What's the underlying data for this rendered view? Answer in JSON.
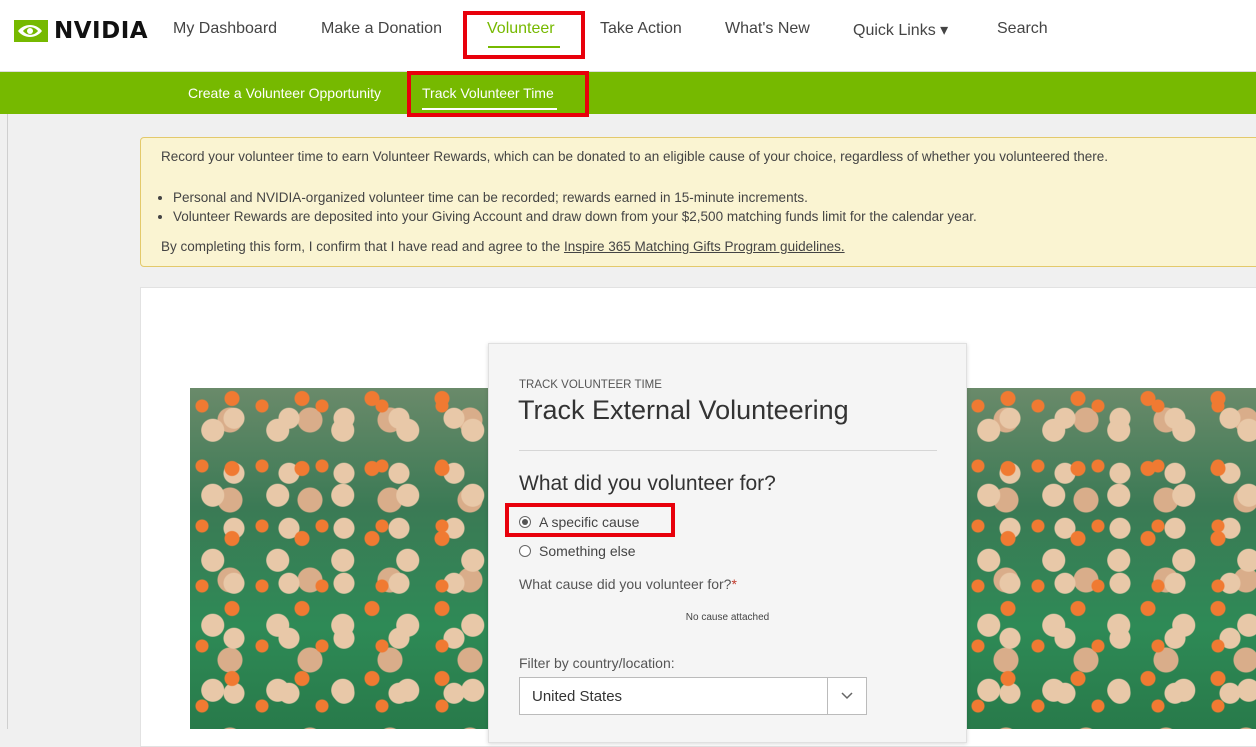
{
  "brand": {
    "name": "NVIDIA",
    "accent": "#76b900",
    "highlight": "#e8000b"
  },
  "nav": {
    "items": [
      {
        "label": "My Dashboard"
      },
      {
        "label": "Make a Donation"
      },
      {
        "label": "Volunteer",
        "active": true
      },
      {
        "label": "Take Action"
      },
      {
        "label": "What's New"
      },
      {
        "label": "Quick Links ▾"
      },
      {
        "label": "Search"
      }
    ]
  },
  "subnav": {
    "items": [
      {
        "label": "Create a Volunteer Opportunity"
      },
      {
        "label": "Track Volunteer Time",
        "active": true
      }
    ]
  },
  "notice": {
    "intro": "Record your volunteer time to earn Volunteer Rewards, which can be donated to an eligible cause of your choice, regardless of whether you volunteered there.",
    "bullets": [
      "Personal and NVIDIA-organized volunteer time can be recorded; rewards earned in 15-minute increments.",
      "Volunteer Rewards are deposited into your Giving Account and draw down from your $2,500 matching funds limit for the calendar year."
    ],
    "confirm_prefix": "By completing this form, I confirm that I have read and agree to the ",
    "confirm_link": "Inspire 365 Matching Gifts Program guidelines."
  },
  "form": {
    "eyebrow": "TRACK VOLUNTEER TIME",
    "title": "Track External Volunteering",
    "question": "What did you volunteer for?",
    "options": [
      {
        "label": "A specific cause",
        "selected": true
      },
      {
        "label": "Something else",
        "selected": false
      }
    ],
    "cause_label": "What cause did you volunteer for?",
    "required_mark": "*",
    "no_cause": "No cause attached",
    "filter_label": "Filter by country/location:",
    "country_value": "United States"
  }
}
